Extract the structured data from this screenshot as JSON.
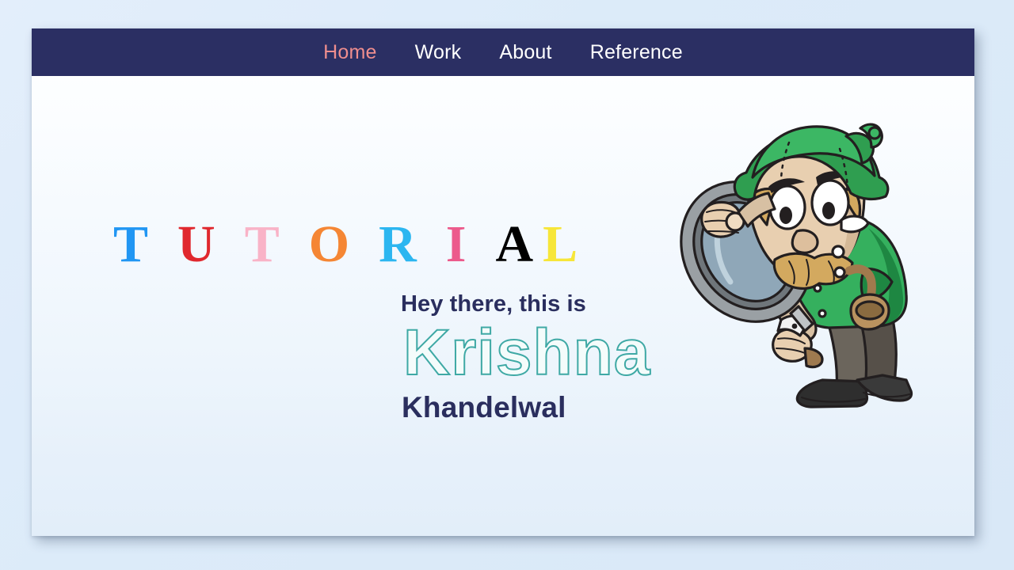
{
  "window": {
    "page_background_color": "#dbe9f8",
    "panel_background_top": "#ffffff",
    "panel_background_bottom": "#e2eef9"
  },
  "navbar": {
    "background_color": "#2b2f63",
    "active_color": "#ef8e8e",
    "inactive_color": "#ffffff",
    "items": [
      {
        "label": "Home",
        "active": true
      },
      {
        "label": "Work",
        "active": false
      },
      {
        "label": "About",
        "active": false
      },
      {
        "label": "Reference",
        "active": false
      }
    ]
  },
  "heading": {
    "text": "TUTORIAL",
    "letters": [
      {
        "char": "T",
        "color": "#2196f3"
      },
      {
        "char": "U",
        "color": "#e0282e"
      },
      {
        "char": "T",
        "color": "#f9b3c7"
      },
      {
        "char": "O",
        "color": "#f58634"
      },
      {
        "char": "R",
        "color": "#2cb6f0"
      },
      {
        "char": "I",
        "color": "#ec5b8c"
      },
      {
        "char": "A",
        "color": "#2eb martial"
      },
      {
        "char": "L",
        "color": "#f7e639"
      }
    ]
  },
  "hero": {
    "greeting": "Hey there, this is",
    "first_name": "Krishna",
    "last_name": "Khandelwal",
    "first_name_stroke_color": "#3fa9a5",
    "first_name_fill_color": "#f4fcfb",
    "text_color": "#2a2e5e"
  },
  "illustration": {
    "name": "detective-with-magnifying-glass",
    "description": "Cartoon detective in a green deerstalker hat and green coat, holding a magnifying glass, smoking a pipe",
    "colors": {
      "hat_green": "#2f9e50",
      "hat_green_dark": "#1f7a3c",
      "coat_green": "#35b05e",
      "coat_green_dark": "#1e8742",
      "skin": "#e8cfb0",
      "skin_shadow": "#cbb094",
      "hair": "#d3a95f",
      "pants": "#5a5650",
      "shoe": "#2d2d2d",
      "glass_rim": "#9aa0a4",
      "glass_lens": "#8fa7b8",
      "outline": "#231f20"
    }
  }
}
